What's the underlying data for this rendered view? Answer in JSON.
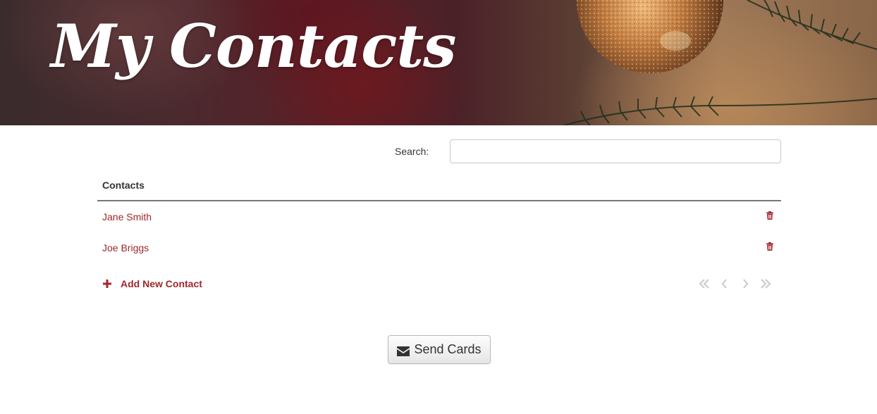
{
  "header": {
    "title": "My Contacts"
  },
  "search": {
    "label": "Search:",
    "value": "",
    "placeholder": ""
  },
  "table": {
    "column_header": "Contacts",
    "rows": [
      {
        "name": "Jane Smith",
        "action_icon": "trash-icon"
      },
      {
        "name": "Joe Briggs",
        "action_icon": "trash-icon"
      }
    ]
  },
  "footer": {
    "add_label": "Add New Contact",
    "add_icon": "plus-icon",
    "pager_icons": [
      "double-chevron-left-icon",
      "chevron-left-icon",
      "chevron-right-icon",
      "double-chevron-right-icon"
    ]
  },
  "send_button": {
    "label": "Send Cards",
    "icon": "envelope-icon"
  },
  "colors": {
    "accent": "#a0262a",
    "pager_disabled": "#c9c9c9",
    "text": "#333333"
  }
}
